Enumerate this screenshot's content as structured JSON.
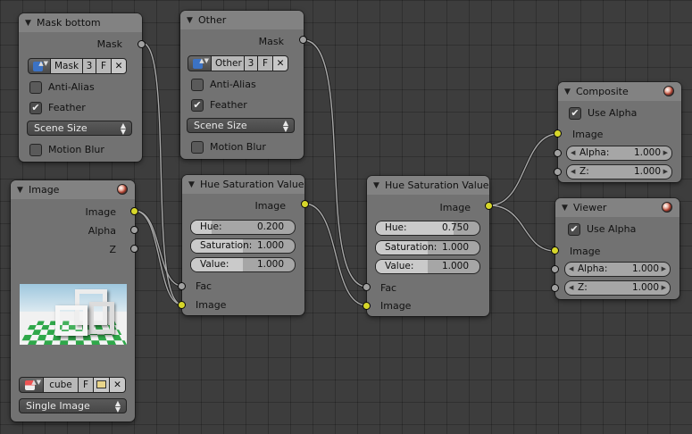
{
  "nodes": {
    "mask_bottom": {
      "title": "Mask bottom",
      "output": "Mask",
      "mask_name": "Mask",
      "users": "3",
      "fake": "F",
      "clear": "✕",
      "anti_alias": "Anti-Alias",
      "feather": "Feather",
      "size_mode": "Scene Size",
      "motion_blur": "Motion Blur"
    },
    "other": {
      "title": "Other",
      "output": "Mask",
      "mask_name": "Other",
      "users": "3",
      "fake": "F",
      "clear": "✕",
      "anti_alias": "Anti-Alias",
      "feather": "Feather",
      "size_mode": "Scene Size",
      "motion_blur": "Motion Blur"
    },
    "image": {
      "title": "Image",
      "outputs": [
        "Image",
        "Alpha",
        "Z"
      ],
      "image_name": "cube",
      "fake": "F",
      "clear": "✕",
      "source": "Single Image"
    },
    "hsv1": {
      "title": "Hue Saturation Value",
      "output": "Image",
      "hue_label": "Hue:",
      "hue": "0.200",
      "sat_label": "Saturation:",
      "sat": "1.000",
      "val_label": "Value:",
      "val": "1.000",
      "fac": "Fac",
      "input": "Image"
    },
    "hsv2": {
      "title": "Hue Saturation Value",
      "output": "Image",
      "hue_label": "Hue:",
      "hue": "0.750",
      "sat_label": "Saturation:",
      "sat": "1.000",
      "val_label": "Value:",
      "val": "1.000",
      "fac": "Fac",
      "input": "Image"
    },
    "composite": {
      "title": "Composite",
      "use_alpha": "Use Alpha",
      "input": "Image",
      "alpha_label": "Alpha:",
      "alpha": "1.000",
      "z_label": "Z:",
      "z": "1.000"
    },
    "viewer": {
      "title": "Viewer",
      "use_alpha": "Use Alpha",
      "input": "Image",
      "alpha_label": "Alpha:",
      "alpha": "1.000",
      "z_label": "Z:",
      "z": "1.000"
    }
  },
  "glyphs": {
    "collapse": "▼",
    "check": "✔",
    "updown": "▲▼",
    "left": "◀",
    "right": "▶"
  },
  "colors": {
    "image_socket": "#d7d72a",
    "value_socket": "#a1a1a1",
    "node_body": "#727272",
    "editor_bg": "#3d3d3d"
  }
}
